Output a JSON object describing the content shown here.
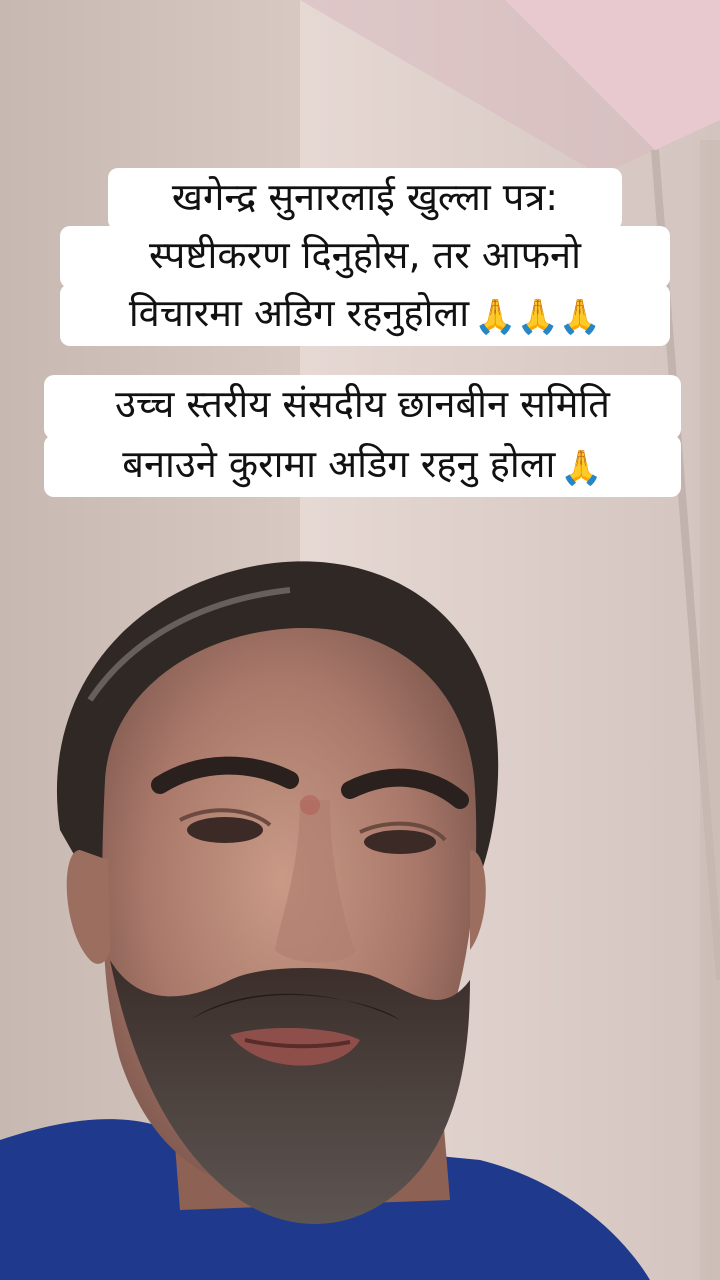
{
  "caption_primary": {
    "lines": [
      "खगेन्द्र सुनारलाई खुल्ला पत्र:",
      "स्पष्टीकरण दिनुहोस, तर आफनो",
      "विचारमा अडिग रहनुहोला"
    ],
    "emoji": "🙏🙏🙏"
  },
  "caption_secondary": {
    "lines": [
      "उच्च स्तरीय संसदीय छानबीन समिति",
      "बनाउने कुरामा अडिग रहनु होला"
    ],
    "emoji": "🙏"
  },
  "colors": {
    "caption_bg": "#ffffff",
    "caption_text": "#111111",
    "wall": "#dccdc7",
    "shirt": "#1f3a8c"
  }
}
